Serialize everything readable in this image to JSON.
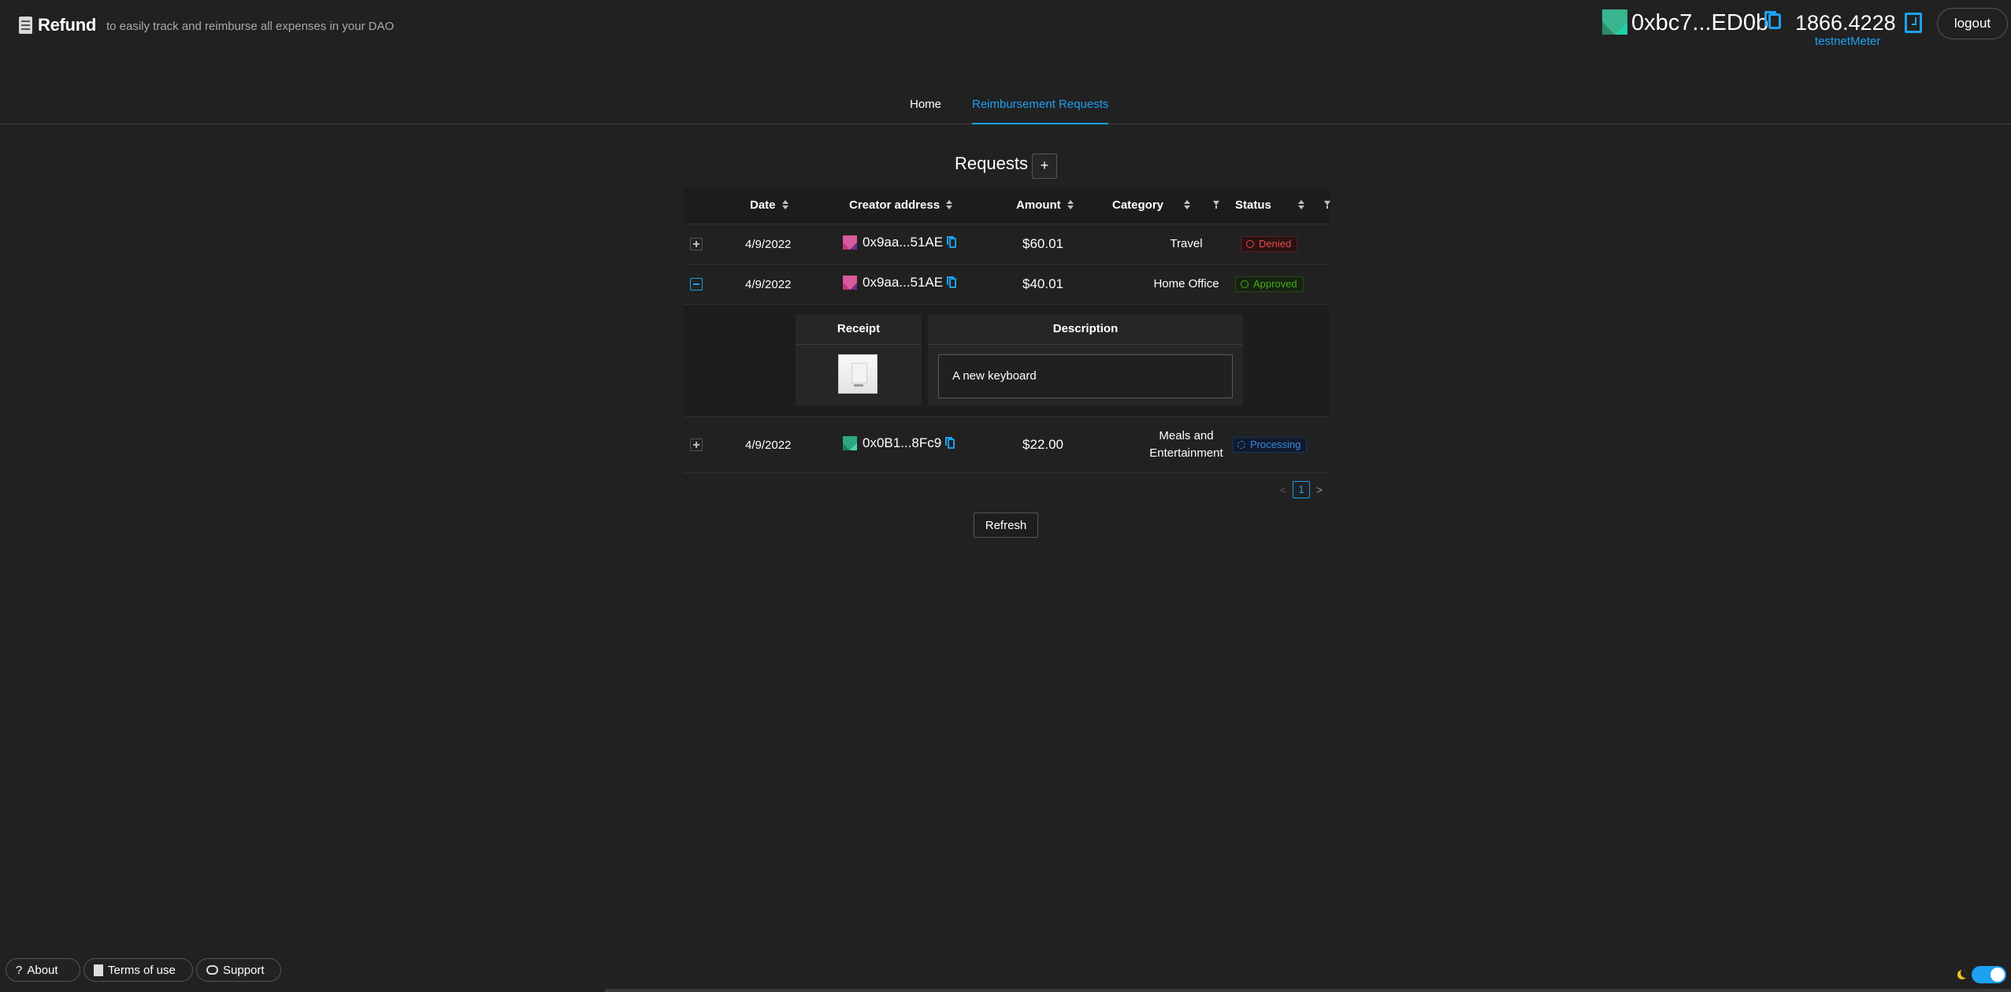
{
  "header": {
    "brand": "Refund",
    "tagline": "to easily track and reimburse all expenses in your DAO",
    "account_address": "0xbc7...ED0b",
    "balance": "1866.4228",
    "network": "testnetMeter",
    "logout_label": "logout"
  },
  "nav": {
    "tabs": [
      {
        "label": "Home",
        "active": false
      },
      {
        "label": "Reimbursement Requests",
        "active": true
      }
    ]
  },
  "requests": {
    "title": "Requests",
    "add_label": "+",
    "columns": [
      "Date",
      "Creator address",
      "Amount",
      "Category",
      "Status"
    ],
    "rows": [
      {
        "date": "4/9/2022",
        "creator": "0x9aa...51AE",
        "amount": "$60.01",
        "category": "Travel",
        "status": "Denied",
        "expanded": false
      },
      {
        "date": "4/9/2022",
        "creator": "0x9aa...51AE",
        "amount": "$40.01",
        "category": "Home Office",
        "status": "Approved",
        "expanded": true,
        "detail": {
          "receipt_header": "Receipt",
          "description_header": "Description",
          "description": "A new keyboard"
        }
      },
      {
        "date": "4/9/2022",
        "creator": "0x0B1...8Fc9",
        "amount": "$22.00",
        "category": "Meals and Entertainment",
        "status": "Processing",
        "expanded": false
      }
    ],
    "pagination": {
      "current": "1",
      "prev": "<",
      "next": ">"
    },
    "refresh_label": "Refresh"
  },
  "footer": {
    "about": "About",
    "about_icon": "?",
    "terms": "Terms of use",
    "support": "Support"
  },
  "colors": {
    "background": "#212121",
    "accent": "#1da1f2",
    "denied": "#e84749",
    "approved": "#49aa19",
    "processing": "#3c89e8"
  }
}
